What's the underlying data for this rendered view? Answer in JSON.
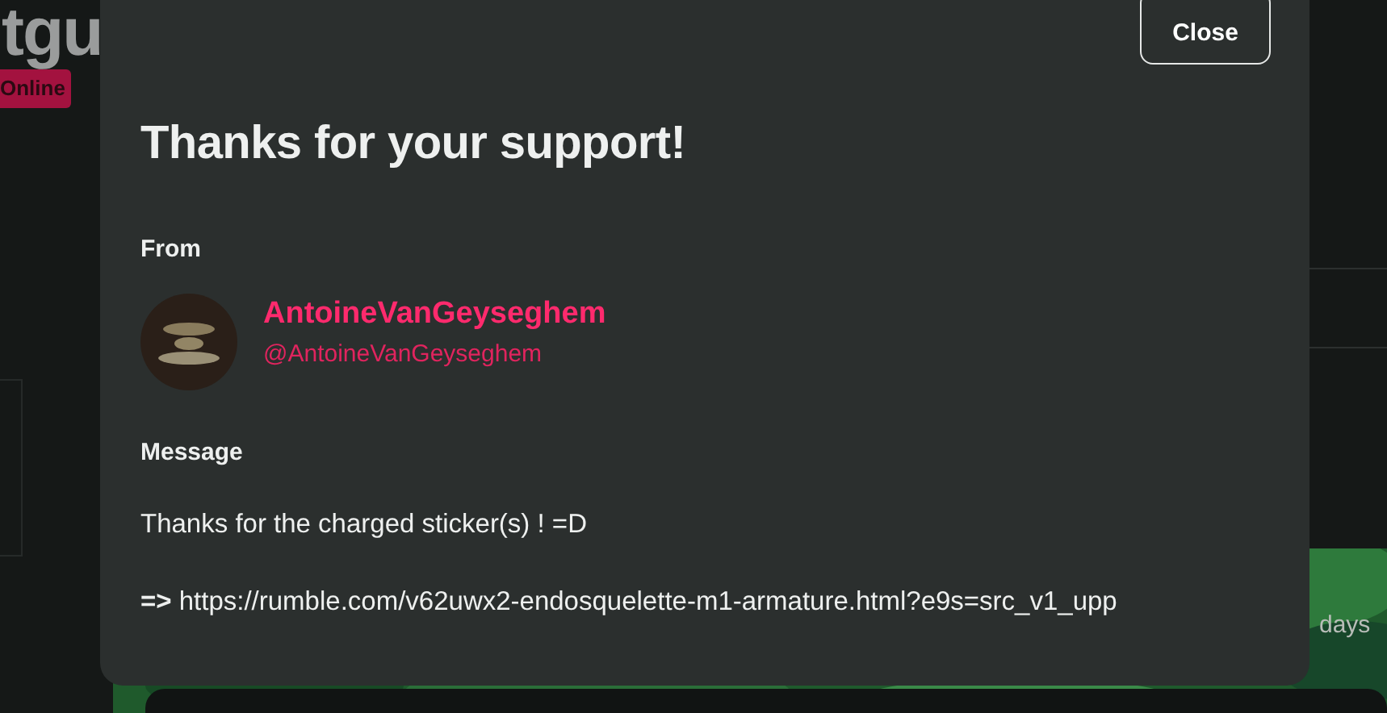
{
  "background": {
    "title": "tgu",
    "status_badge": "Online",
    "footer_text": "days"
  },
  "modal": {
    "close_button": "Close",
    "title": "Thanks for your support!",
    "from_label": "From",
    "sender": {
      "name": "AntoineVanGeyseghem",
      "handle": "@AntoineVanGeyseghem"
    },
    "message_label": "Message",
    "message": [
      "Thanks for the charged sticker(s) ! =D",
      "**=>** https://rumble.com/v62uwx2-endosquelette-m1-armature.html?e9s=src_v1_upp"
    ]
  }
}
